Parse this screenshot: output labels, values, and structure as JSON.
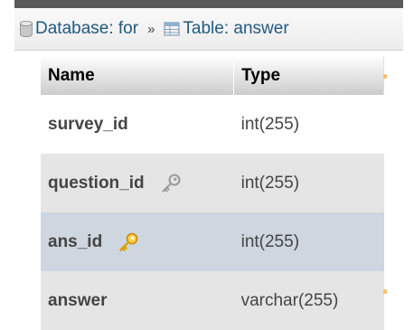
{
  "breadcrumb": {
    "database_label": "Database: for",
    "separator": "»",
    "table_label": "Table: answer"
  },
  "table": {
    "columns": [
      "Name",
      "Type"
    ],
    "rows": [
      {
        "name": "survey_id",
        "type": "int(255)",
        "key_icon": null
      },
      {
        "name": "question_id",
        "type": "int(255)",
        "key_icon": "key-icon-grey"
      },
      {
        "name": "ans_id",
        "type": "int(255)",
        "key_icon": "key-icon-gold"
      },
      {
        "name": "answer",
        "type": "varchar(255)",
        "key_icon": null
      }
    ]
  },
  "colors": {
    "link": "#235a81",
    "header_bar": "#5a5a5a",
    "row_even": "#e5e5e5",
    "row_marked": "#ced6df",
    "primary_key": "#f0b400"
  }
}
